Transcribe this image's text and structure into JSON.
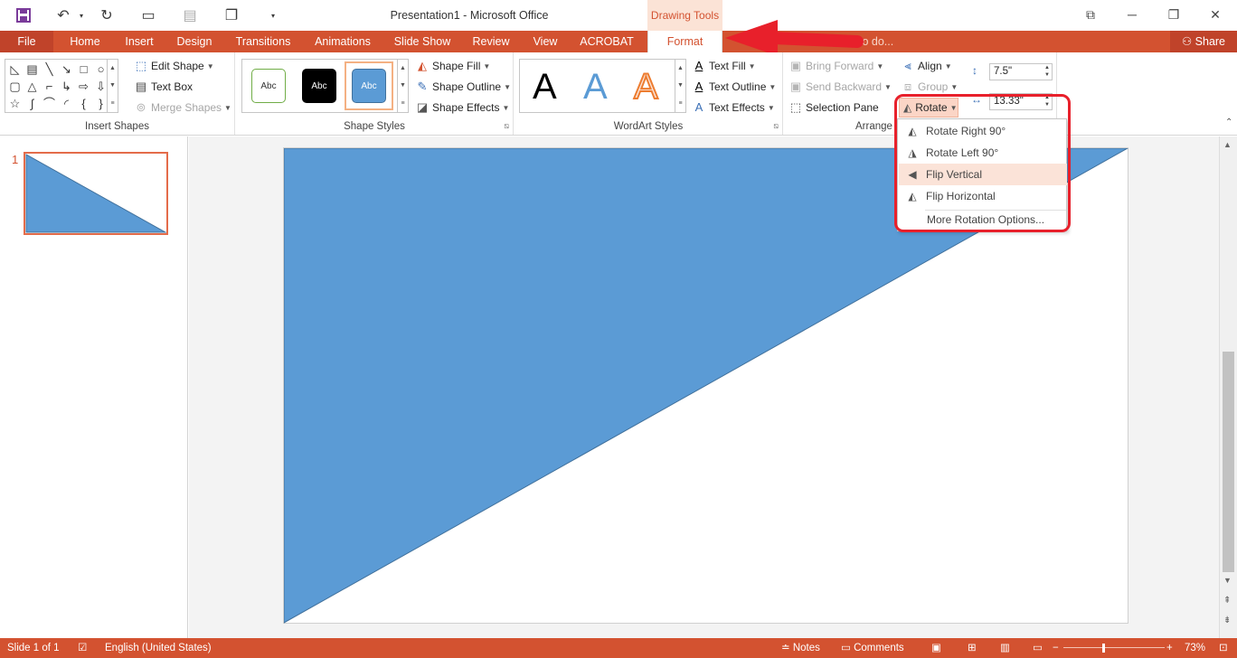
{
  "app": {
    "title": "Presentation1 - Microsoft Office",
    "contextual_tab_group": "Drawing Tools"
  },
  "tabs": [
    "File",
    "Home",
    "Insert",
    "Design",
    "Transitions",
    "Animations",
    "Slide Show",
    "Review",
    "View",
    "ACROBAT",
    "Format"
  ],
  "active_tab": "Format",
  "tell_me": "to do...",
  "share_label": "Share",
  "ribbon": {
    "insert_shapes": {
      "label": "Insert Shapes",
      "edit_shape": "Edit Shape",
      "text_box": "Text Box",
      "merge_shapes": "Merge Shapes"
    },
    "shape_styles": {
      "label": "Shape Styles",
      "style_sample": "Abc",
      "shape_fill": "Shape Fill",
      "shape_outline": "Shape Outline",
      "shape_effects": "Shape Effects"
    },
    "wordart_styles": {
      "label": "WordArt Styles",
      "sample_letter": "A",
      "text_fill": "Text Fill",
      "text_outline": "Text Outline",
      "text_effects": "Text Effects"
    },
    "arrange": {
      "label": "Arrange",
      "bring_forward": "Bring Forward",
      "send_backward": "Send Backward",
      "selection_pane": "Selection Pane",
      "align": "Align",
      "group": "Group",
      "rotate": "Rotate"
    },
    "size": {
      "height": "7.5\"",
      "width": "13.33\""
    }
  },
  "rotate_menu": {
    "items": [
      "Rotate Right 90°",
      "Rotate Left 90°",
      "Flip Vertical",
      "Flip Horizontal"
    ],
    "more": "More Rotation Options...",
    "highlighted": "Flip Vertical"
  },
  "slides": {
    "current_number": "1"
  },
  "status": {
    "slide_info": "Slide 1 of 1",
    "language": "English (United States)",
    "notes": "Notes",
    "comments": "Comments",
    "zoom": "73%"
  },
  "colors": {
    "accent": "#d35230",
    "shape_fill": "#5b9bd5",
    "highlight_outline": "#e8202b"
  }
}
